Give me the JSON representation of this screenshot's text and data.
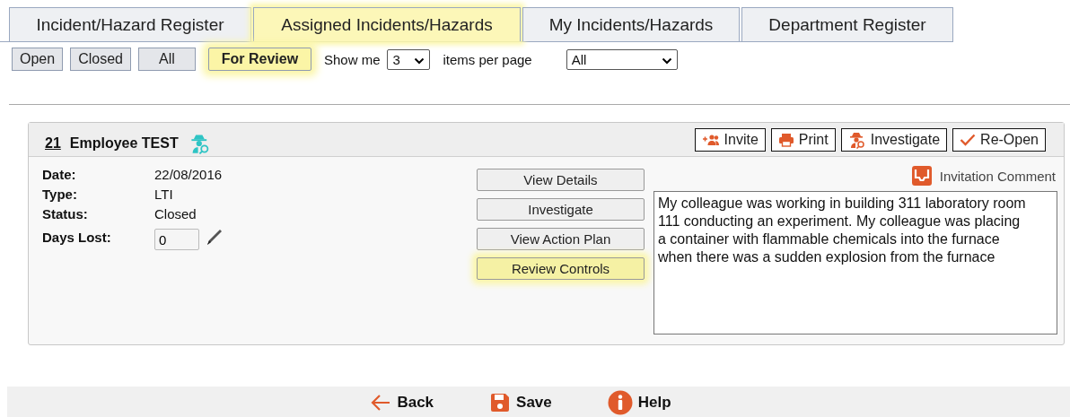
{
  "tabs": [
    {
      "label": "Incident/Hazard Register",
      "selected": false
    },
    {
      "label": "Assigned Incidents/Hazards",
      "selected": true
    },
    {
      "label": "My Incidents/Hazards",
      "selected": false
    },
    {
      "label": "Department Register",
      "selected": false
    }
  ],
  "filters": [
    {
      "label": "Open",
      "selected": false
    },
    {
      "label": "Closed",
      "selected": false
    },
    {
      "label": "All",
      "selected": false
    },
    {
      "label": "For Review",
      "selected": true
    }
  ],
  "paging": {
    "prefix": "Show me",
    "value": "3",
    "suffix": "items per page"
  },
  "scope_select": {
    "value": "All"
  },
  "record": {
    "number": "21",
    "name": "Employee TEST",
    "header_buttons": [
      {
        "label": "Invite",
        "kind": "invite"
      },
      {
        "label": "Print",
        "kind": "print"
      },
      {
        "label": "Investigate",
        "kind": "investigate"
      },
      {
        "label": "Re-Open",
        "kind": "reopen"
      }
    ],
    "fields": [
      {
        "label": "Date:",
        "value": "22/08/2016",
        "kind": "text"
      },
      {
        "label": "Type:",
        "value": "LTI",
        "kind": "text"
      },
      {
        "label": "Status:",
        "value": "Closed",
        "kind": "text"
      },
      {
        "label": "Days Lost:",
        "value": "0",
        "kind": "input"
      }
    ],
    "actions": [
      {
        "label": "View Details",
        "highlighted": false
      },
      {
        "label": "Investigate",
        "highlighted": false
      },
      {
        "label": "View Action Plan",
        "highlighted": false
      },
      {
        "label": "Review Controls",
        "highlighted": true
      }
    ],
    "comment_link": "Invitation Comment",
    "description": "My colleague was working in building 311 laboratory room 111 conducting an experiment. My colleague was placing a container with flammable chemicals into the furnace when there was a sudden explosion from the furnace"
  },
  "footer": [
    {
      "label": "Back",
      "kind": "back"
    },
    {
      "label": "Save",
      "kind": "save"
    },
    {
      "label": "Help",
      "kind": "help"
    }
  ]
}
